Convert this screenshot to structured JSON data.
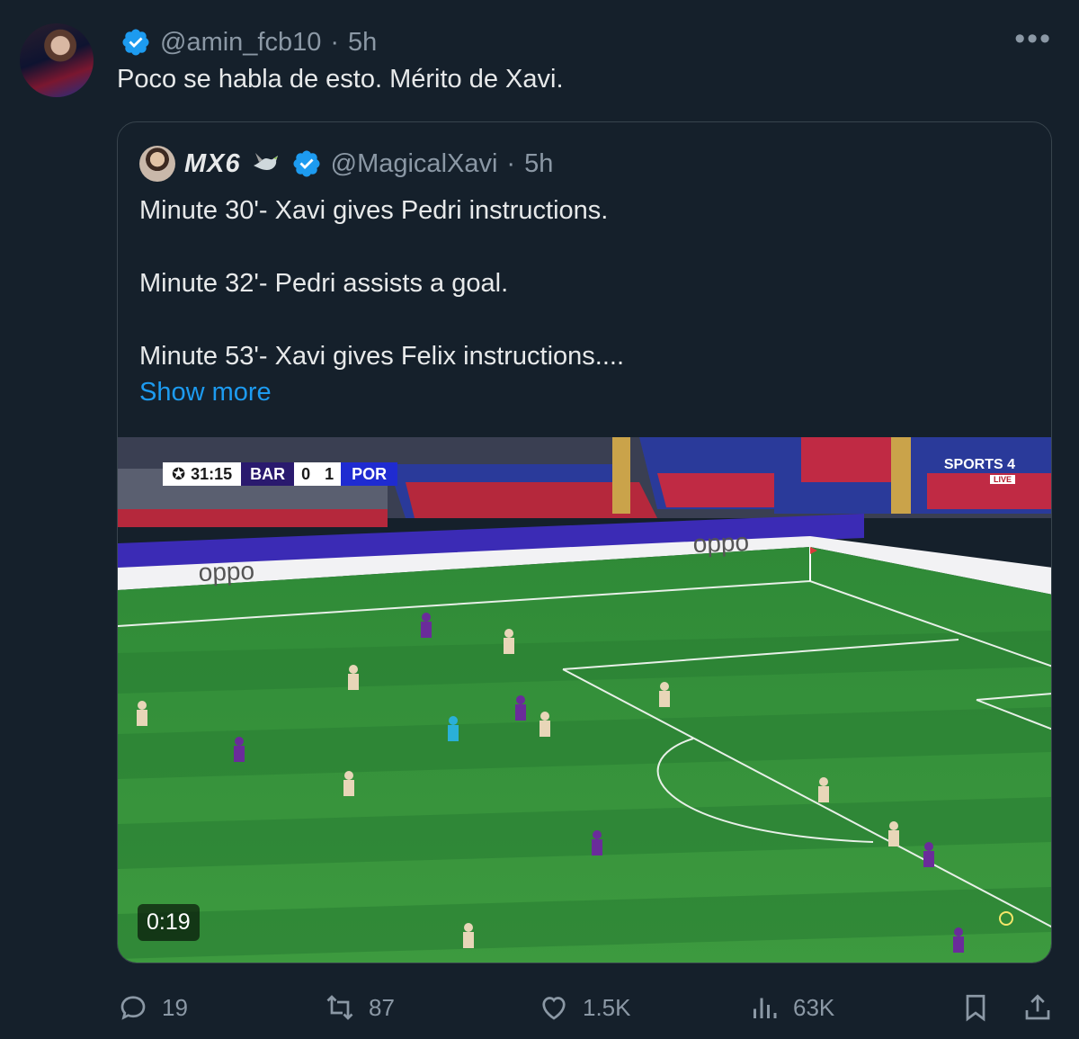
{
  "tweet": {
    "handle": "@amin_fcb10",
    "time": "5h",
    "text": "Poco se habla de esto. Mérito de Xavi.",
    "more_icon": "more-horizontal-icon"
  },
  "quoted": {
    "display_name": "MX6",
    "emoji": "dove-emoji",
    "handle": "@MagicalXavi",
    "time": "5h",
    "lines": [
      "Minute 30'- Xavi gives Pedri instructions.",
      "Minute 32'- Pedri assists a goal.",
      "Minute 53'- Xavi gives Felix instructions...."
    ],
    "show_more": "Show more",
    "video": {
      "duration": "0:19",
      "scorebug": {
        "clock": "31:15",
        "home": "BAR",
        "home_score": "0",
        "away_score": "1",
        "away": "POR"
      },
      "broadcaster": "SPORTS 4",
      "broadcaster_badge": "LIVE",
      "board_brand": "oppo"
    }
  },
  "actions": {
    "reply_count": "19",
    "retweet_count": "87",
    "like_count": "1.5K",
    "view_count": "63K"
  },
  "colors": {
    "background": "#15202b",
    "text": "#e7e9ea",
    "muted": "#8b98a5",
    "link": "#1d9bf0",
    "verified": "#1d9bf0",
    "border": "#38444d"
  }
}
